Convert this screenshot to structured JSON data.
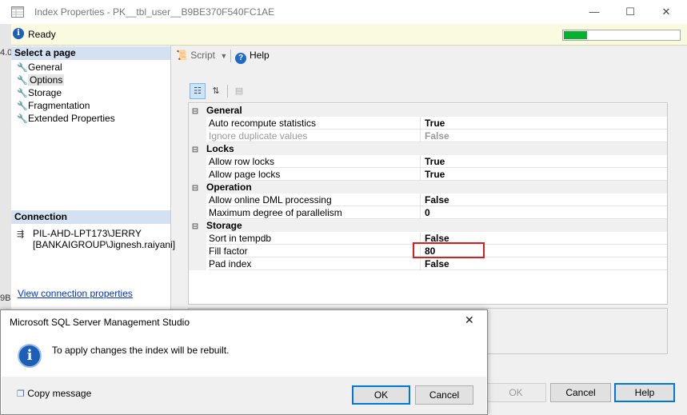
{
  "window": {
    "title": "Index Properties - PK__tbl_user__B9BE370F540FC1AE",
    "minimize_glyph": "—",
    "maximize_glyph": "☐",
    "close_glyph": "✕"
  },
  "status": {
    "text": "Ready",
    "progress": 0.2,
    "progress_color": "#08b030"
  },
  "edge_fragments": {
    "top": "4.0",
    "bottom": "9B"
  },
  "left_panel": {
    "select_page_header": "Select a page",
    "pages": [
      "General",
      "Options",
      "Storage",
      "Fragmentation",
      "Extended Properties"
    ],
    "selected_page": "Options",
    "connection_header": "Connection",
    "server": "PIL-AHD-LPT173\\JERRY",
    "user": "[BANKAIGROUP\\Jignesh.raiyani]",
    "view_connection": "View connection properties"
  },
  "toolbar": {
    "script": "Script",
    "help": "Help"
  },
  "property_grid": {
    "categories": [
      {
        "name": "General",
        "rows": [
          {
            "name": "Auto recompute statistics",
            "value": "True",
            "disabled": false
          },
          {
            "name": "Ignore duplicate values",
            "value": "False",
            "disabled": true
          }
        ]
      },
      {
        "name": "Locks",
        "rows": [
          {
            "name": "Allow row locks",
            "value": "True",
            "disabled": false
          },
          {
            "name": "Allow page locks",
            "value": "True",
            "disabled": false
          }
        ]
      },
      {
        "name": "Operation",
        "rows": [
          {
            "name": "Allow online DML processing",
            "value": "False",
            "disabled": false
          },
          {
            "name": "Maximum degree of parallelism",
            "value": "0",
            "disabled": false
          }
        ]
      },
      {
        "name": "Storage",
        "rows": [
          {
            "name": "Sort in tempdb",
            "value": "False",
            "disabled": false
          },
          {
            "name": "Fill factor",
            "value": "80",
            "disabled": false
          },
          {
            "name": "Pad index",
            "value": "False",
            "disabled": false
          }
        ]
      }
    ]
  },
  "buttons": {
    "ok": "OK",
    "cancel": "Cancel",
    "help": "Help"
  },
  "message_box": {
    "title": "Microsoft SQL Server Management Studio",
    "text": "To apply changes the index will be rebuilt.",
    "copy": "Copy message",
    "ok": "OK",
    "cancel": "Cancel",
    "close_glyph": "✕",
    "info_glyph": "i"
  },
  "colors": {
    "accent": "#0078d7",
    "highlight": "#d42020",
    "link": "#0033cc"
  }
}
